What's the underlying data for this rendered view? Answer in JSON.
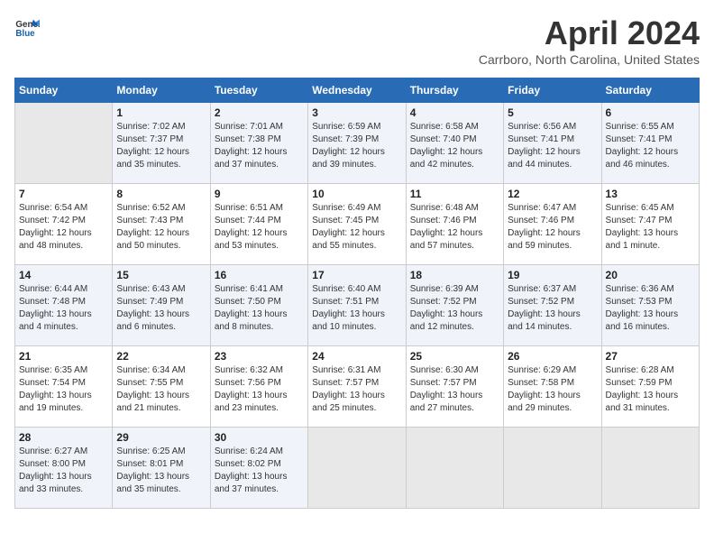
{
  "header": {
    "logo_line1": "General",
    "logo_line2": "Blue",
    "title": "April 2024",
    "subtitle": "Carrboro, North Carolina, United States"
  },
  "weekdays": [
    "Sunday",
    "Monday",
    "Tuesday",
    "Wednesday",
    "Thursday",
    "Friday",
    "Saturday"
  ],
  "weeks": [
    [
      {
        "day": "",
        "sunrise": "",
        "sunset": "",
        "daylight": ""
      },
      {
        "day": "1",
        "sunrise": "Sunrise: 7:02 AM",
        "sunset": "Sunset: 7:37 PM",
        "daylight": "Daylight: 12 hours and 35 minutes."
      },
      {
        "day": "2",
        "sunrise": "Sunrise: 7:01 AM",
        "sunset": "Sunset: 7:38 PM",
        "daylight": "Daylight: 12 hours and 37 minutes."
      },
      {
        "day": "3",
        "sunrise": "Sunrise: 6:59 AM",
        "sunset": "Sunset: 7:39 PM",
        "daylight": "Daylight: 12 hours and 39 minutes."
      },
      {
        "day": "4",
        "sunrise": "Sunrise: 6:58 AM",
        "sunset": "Sunset: 7:40 PM",
        "daylight": "Daylight: 12 hours and 42 minutes."
      },
      {
        "day": "5",
        "sunrise": "Sunrise: 6:56 AM",
        "sunset": "Sunset: 7:41 PM",
        "daylight": "Daylight: 12 hours and 44 minutes."
      },
      {
        "day": "6",
        "sunrise": "Sunrise: 6:55 AM",
        "sunset": "Sunset: 7:41 PM",
        "daylight": "Daylight: 12 hours and 46 minutes."
      }
    ],
    [
      {
        "day": "7",
        "sunrise": "Sunrise: 6:54 AM",
        "sunset": "Sunset: 7:42 PM",
        "daylight": "Daylight: 12 hours and 48 minutes."
      },
      {
        "day": "8",
        "sunrise": "Sunrise: 6:52 AM",
        "sunset": "Sunset: 7:43 PM",
        "daylight": "Daylight: 12 hours and 50 minutes."
      },
      {
        "day": "9",
        "sunrise": "Sunrise: 6:51 AM",
        "sunset": "Sunset: 7:44 PM",
        "daylight": "Daylight: 12 hours and 53 minutes."
      },
      {
        "day": "10",
        "sunrise": "Sunrise: 6:49 AM",
        "sunset": "Sunset: 7:45 PM",
        "daylight": "Daylight: 12 hours and 55 minutes."
      },
      {
        "day": "11",
        "sunrise": "Sunrise: 6:48 AM",
        "sunset": "Sunset: 7:46 PM",
        "daylight": "Daylight: 12 hours and 57 minutes."
      },
      {
        "day": "12",
        "sunrise": "Sunrise: 6:47 AM",
        "sunset": "Sunset: 7:46 PM",
        "daylight": "Daylight: 12 hours and 59 minutes."
      },
      {
        "day": "13",
        "sunrise": "Sunrise: 6:45 AM",
        "sunset": "Sunset: 7:47 PM",
        "daylight": "Daylight: 13 hours and 1 minute."
      }
    ],
    [
      {
        "day": "14",
        "sunrise": "Sunrise: 6:44 AM",
        "sunset": "Sunset: 7:48 PM",
        "daylight": "Daylight: 13 hours and 4 minutes."
      },
      {
        "day": "15",
        "sunrise": "Sunrise: 6:43 AM",
        "sunset": "Sunset: 7:49 PM",
        "daylight": "Daylight: 13 hours and 6 minutes."
      },
      {
        "day": "16",
        "sunrise": "Sunrise: 6:41 AM",
        "sunset": "Sunset: 7:50 PM",
        "daylight": "Daylight: 13 hours and 8 minutes."
      },
      {
        "day": "17",
        "sunrise": "Sunrise: 6:40 AM",
        "sunset": "Sunset: 7:51 PM",
        "daylight": "Daylight: 13 hours and 10 minutes."
      },
      {
        "day": "18",
        "sunrise": "Sunrise: 6:39 AM",
        "sunset": "Sunset: 7:52 PM",
        "daylight": "Daylight: 13 hours and 12 minutes."
      },
      {
        "day": "19",
        "sunrise": "Sunrise: 6:37 AM",
        "sunset": "Sunset: 7:52 PM",
        "daylight": "Daylight: 13 hours and 14 minutes."
      },
      {
        "day": "20",
        "sunrise": "Sunrise: 6:36 AM",
        "sunset": "Sunset: 7:53 PM",
        "daylight": "Daylight: 13 hours and 16 minutes."
      }
    ],
    [
      {
        "day": "21",
        "sunrise": "Sunrise: 6:35 AM",
        "sunset": "Sunset: 7:54 PM",
        "daylight": "Daylight: 13 hours and 19 minutes."
      },
      {
        "day": "22",
        "sunrise": "Sunrise: 6:34 AM",
        "sunset": "Sunset: 7:55 PM",
        "daylight": "Daylight: 13 hours and 21 minutes."
      },
      {
        "day": "23",
        "sunrise": "Sunrise: 6:32 AM",
        "sunset": "Sunset: 7:56 PM",
        "daylight": "Daylight: 13 hours and 23 minutes."
      },
      {
        "day": "24",
        "sunrise": "Sunrise: 6:31 AM",
        "sunset": "Sunset: 7:57 PM",
        "daylight": "Daylight: 13 hours and 25 minutes."
      },
      {
        "day": "25",
        "sunrise": "Sunrise: 6:30 AM",
        "sunset": "Sunset: 7:57 PM",
        "daylight": "Daylight: 13 hours and 27 minutes."
      },
      {
        "day": "26",
        "sunrise": "Sunrise: 6:29 AM",
        "sunset": "Sunset: 7:58 PM",
        "daylight": "Daylight: 13 hours and 29 minutes."
      },
      {
        "day": "27",
        "sunrise": "Sunrise: 6:28 AM",
        "sunset": "Sunset: 7:59 PM",
        "daylight": "Daylight: 13 hours and 31 minutes."
      }
    ],
    [
      {
        "day": "28",
        "sunrise": "Sunrise: 6:27 AM",
        "sunset": "Sunset: 8:00 PM",
        "daylight": "Daylight: 13 hours and 33 minutes."
      },
      {
        "day": "29",
        "sunrise": "Sunrise: 6:25 AM",
        "sunset": "Sunset: 8:01 PM",
        "daylight": "Daylight: 13 hours and 35 minutes."
      },
      {
        "day": "30",
        "sunrise": "Sunrise: 6:24 AM",
        "sunset": "Sunset: 8:02 PM",
        "daylight": "Daylight: 13 hours and 37 minutes."
      },
      {
        "day": "",
        "sunrise": "",
        "sunset": "",
        "daylight": ""
      },
      {
        "day": "",
        "sunrise": "",
        "sunset": "",
        "daylight": ""
      },
      {
        "day": "",
        "sunrise": "",
        "sunset": "",
        "daylight": ""
      },
      {
        "day": "",
        "sunrise": "",
        "sunset": "",
        "daylight": ""
      }
    ]
  ]
}
